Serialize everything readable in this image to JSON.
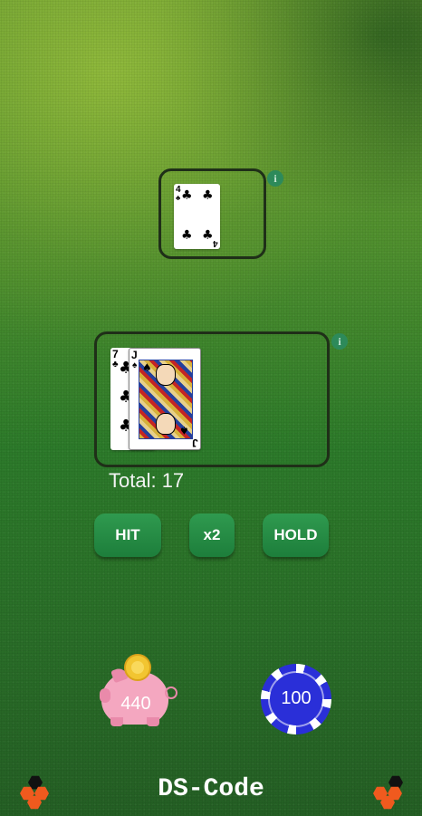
{
  "dealer": {
    "cards": [
      {
        "rank": "4",
        "suit": "clubs",
        "suit_symbol": "♣"
      }
    ],
    "info_label": "i"
  },
  "player": {
    "cards": [
      {
        "rank": "7",
        "suit": "clubs",
        "suit_symbol": "♣"
      },
      {
        "rank": "J",
        "suit": "spades",
        "suit_symbol": "♠"
      }
    ],
    "info_label": "i",
    "total_text": "Total: 17"
  },
  "actions": {
    "hit_label": "HIT",
    "double_label": "x2",
    "hold_label": "HOLD"
  },
  "bank": {
    "balance": "440",
    "icon": "piggy-bank-icon"
  },
  "bet": {
    "chip_value": "100",
    "icon": "poker-chip-icon"
  },
  "footer": {
    "brand": "DS-Code",
    "logo_icon": "hexagon-logo-icon"
  },
  "colors": {
    "button": "#1d7e3b",
    "area_border": "#1f2f18",
    "chip": "#2a2fd8",
    "piggy": "#f4a7c0",
    "logo_orange": "#f05a1e",
    "logo_black": "#111111"
  }
}
